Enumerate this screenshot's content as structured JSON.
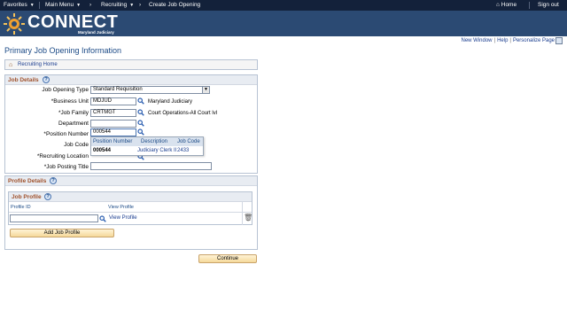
{
  "topnav": {
    "favorites": "Favorites",
    "main_menu": "Main Menu",
    "breadcrumb_1": "Recruiting",
    "breadcrumb_2": "Create Job Opening",
    "home": "Home",
    "sign_out": "Sign out"
  },
  "banner": {
    "logo_text": "CONNECT",
    "logo_sub": "Maryland Judiciary"
  },
  "pagelinks": {
    "new_window": "New Window",
    "help": "Help",
    "personalize": "Personalize Page"
  },
  "page_title": "Primary Job Opening Information",
  "recruiting_home": "Recruiting Home",
  "job_details": {
    "title": "Job Details",
    "job_opening_type_label": "Job Opening Type",
    "job_opening_type_value": "Standard Requisition",
    "business_unit_label": "*Business Unit",
    "business_unit_value": "MDJUD",
    "business_unit_desc": "Maryland Judiciary",
    "job_family_label": "*Job Family",
    "job_family_value": "CRTMGT",
    "job_family_desc": "Court Operations-All Court lvl",
    "department_label": "Department",
    "department_value": "",
    "position_number_label": "*Position Number",
    "position_number_value": "000544",
    "job_code_label": "Job Code",
    "recruiting_location_label": "*Recruiting Location",
    "job_posting_title_label": "*Job Posting Title",
    "job_posting_title_value": ""
  },
  "position_prompt": {
    "col_position_number": "Position Number",
    "col_description": "Description",
    "col_job_code": "Job Code",
    "row_position_number": "000544",
    "row_description": "Judiciary Clerk II",
    "row_job_code": "2433"
  },
  "profile_details": {
    "title": "Profile Details",
    "job_profile_title": "Job Profile",
    "col_profile_id": "Profile ID",
    "col_view_profile": "View Profile",
    "view_profile_link": "View Profile",
    "add_job_profile": "Add Job Profile"
  },
  "continue_label": "Continue"
}
